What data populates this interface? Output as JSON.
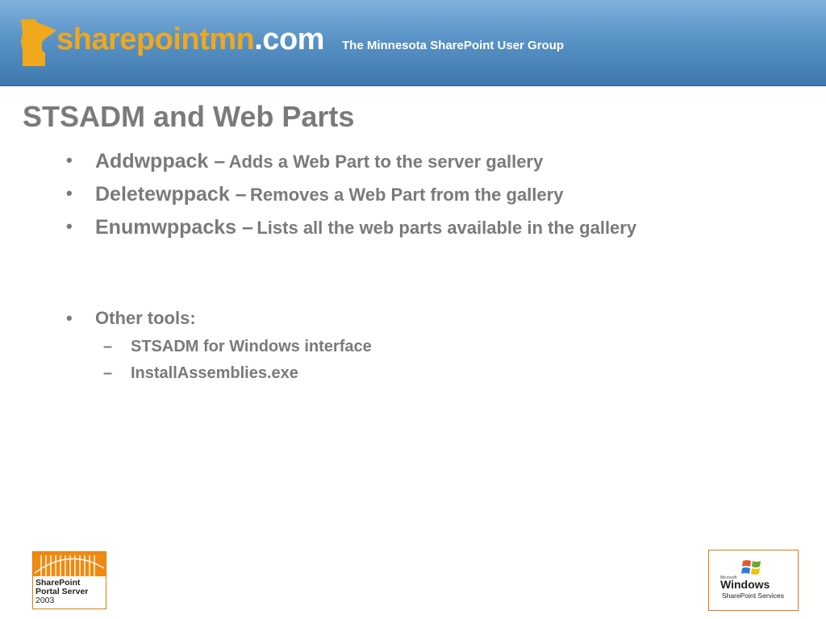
{
  "header": {
    "brand_part1": "sharepointmn",
    "brand_part2": ".com",
    "tagline": "The Minnesota SharePoint User Group"
  },
  "slide": {
    "title": "STSADM and Web Parts",
    "bullets": [
      {
        "command": "Addwppack –",
        "description": "Adds a Web Part to the server gallery"
      },
      {
        "command": "Deletewppack –",
        "description": "Removes a Web Part from the gallery"
      },
      {
        "command": "Enumwppacks –",
        "description": "Lists all the web parts available in the gallery"
      },
      {
        "command": "Other tools:",
        "description": ""
      }
    ],
    "sub_bullets": [
      "STSADM for Windows interface",
      "InstallAssemblies.exe"
    ]
  },
  "footer": {
    "left_logo_lines": [
      "SharePoint",
      "Portal Server",
      "2003"
    ],
    "right_logo": {
      "microsoft": "Microsoft",
      "windows": "Windows",
      "product": "SharePoint Services"
    }
  },
  "colors": {
    "accent": "#f0a81c",
    "header_blue": "#4f88bd",
    "text_gray": "#7a7a7a",
    "logo_orange": "#f08a10"
  }
}
